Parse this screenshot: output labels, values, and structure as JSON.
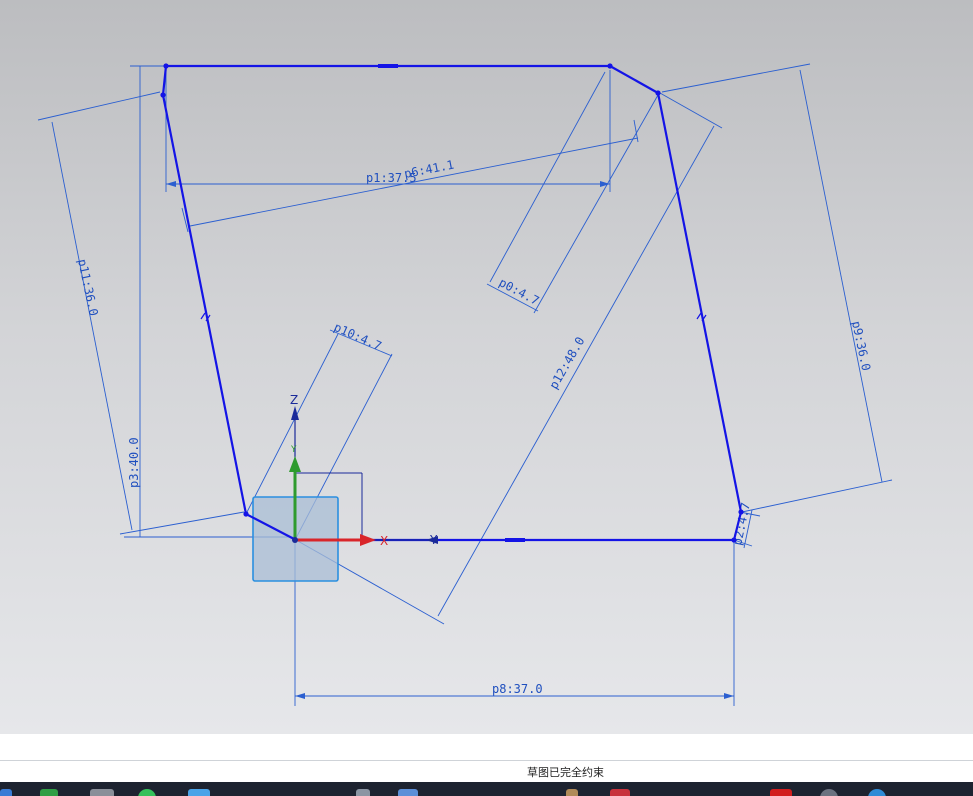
{
  "status": {
    "message": "草图已完全约束"
  },
  "dimensions": {
    "p1": "p1:37.5",
    "p6": "p6:41.1",
    "p0": "p0:4.7",
    "p10": "p10:4.7",
    "p11": "p11:36.0",
    "p12": "p12:48.0",
    "p9": "p9:36.0",
    "p3": "p3:40.0",
    "p8": "p8:37.0",
    "p2": "p2:4.7"
  },
  "axes": {
    "x": "X",
    "y": "Y",
    "z": "Z"
  },
  "colors": {
    "profile": "#1414e6",
    "dimension": "#2b5fd0",
    "x_axis": "#d9252a",
    "z_axis": "#2e9b2e",
    "csys_box": "#a9bed6"
  },
  "taskbar": {
    "icons": [
      "start-icon",
      "excel-icon",
      "file-explorer-icon",
      "wechat-icon",
      "app-store-icon",
      "nx-icon",
      "printer-icon",
      "tray-app-icon",
      "wps-icon",
      "network-icon",
      "sound-icon"
    ]
  }
}
